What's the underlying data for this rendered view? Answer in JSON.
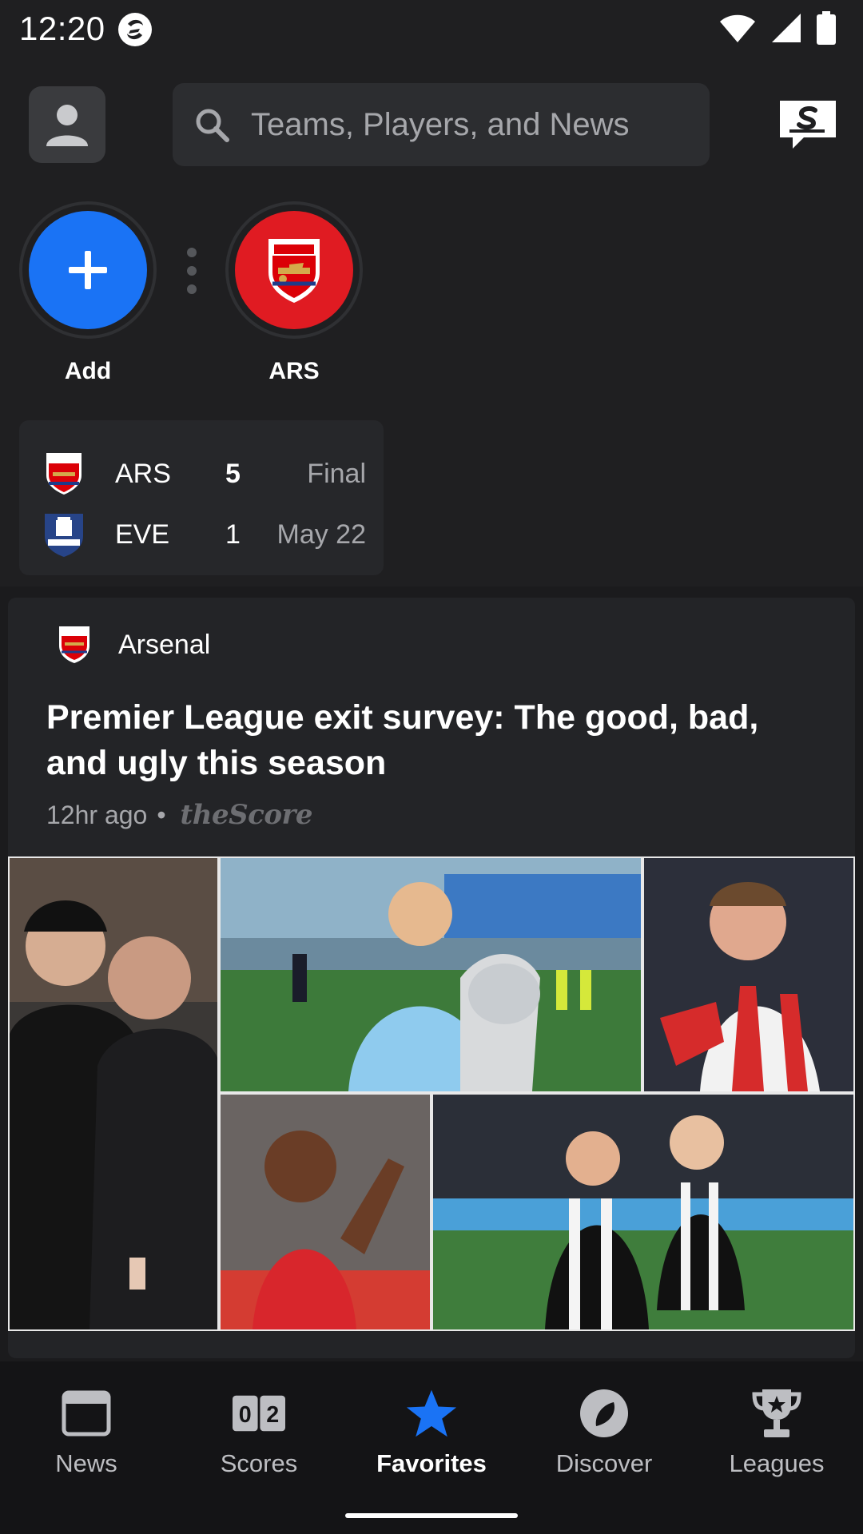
{
  "status_bar": {
    "time": "12:20"
  },
  "header": {
    "search_placeholder": "Teams, Players, and News"
  },
  "favorites": [
    {
      "label": "Add",
      "color": "#1a73f5"
    },
    {
      "label": "ARS",
      "color": "#e01b22"
    }
  ],
  "score_card": {
    "rows": [
      {
        "team": "ARS",
        "score": "5",
        "info": "Final"
      },
      {
        "team": "EVE",
        "score": "1",
        "info": "May 22"
      }
    ]
  },
  "news": {
    "team_name": "Arsenal",
    "title": "Premier League exit survey: The good, bad, and ugly this season",
    "time_ago": "12hr ago",
    "separator": "•",
    "source": "theScore"
  },
  "bottom_nav": {
    "items": [
      {
        "label": "News",
        "icon": "news-icon"
      },
      {
        "label": "Scores",
        "icon": "scores-icon"
      },
      {
        "label": "Favorites",
        "icon": "star-icon"
      },
      {
        "label": "Discover",
        "icon": "compass-icon"
      },
      {
        "label": "Leagues",
        "icon": "trophy-icon"
      }
    ],
    "active": "Favorites"
  },
  "colors": {
    "accent": "#1a73f5",
    "arsenal_red": "#e01b22",
    "everton_blue": "#274488"
  }
}
